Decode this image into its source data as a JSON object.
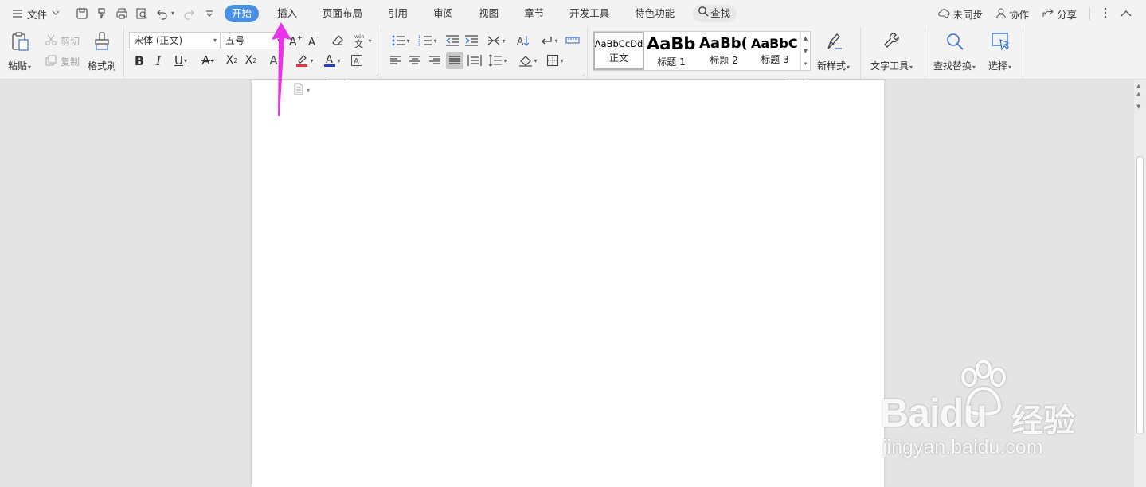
{
  "menubar": {
    "file_label": "文件",
    "tabs": [
      "开始",
      "插入",
      "页面布局",
      "引用",
      "审阅",
      "视图",
      "章节",
      "开发工具",
      "特色功能"
    ],
    "active_tab_index": 0,
    "search_label": "查找",
    "sync_label": "未同步",
    "collab_label": "协作",
    "share_label": "分享"
  },
  "ribbon": {
    "paste_label": "粘贴",
    "cut_label": "剪切",
    "copy_label": "复制",
    "format_painter_label": "格式刷",
    "font_name": "宋体 (正文)",
    "font_size": "五号",
    "styles": [
      {
        "sample": "AaBbCcDd",
        "name": "正文"
      },
      {
        "sample": "AaBb",
        "name": "标题 1"
      },
      {
        "sample": "AaBb(",
        "name": "标题 2"
      },
      {
        "sample": "AaBbC(",
        "name": "标题 3"
      }
    ],
    "new_style_label": "新样式",
    "text_tools_label": "文字工具",
    "find_replace_label": "查找替换",
    "select_label": "选择"
  },
  "watermark": {
    "brand": "Baidu",
    "cn": "经验",
    "url": "jingyan.baidu.com"
  },
  "colors": {
    "active_tab": "#4a90e2",
    "highlight": "#e53935",
    "font_color": "#1a3fd1",
    "annotation_arrow": "#e833e8"
  }
}
